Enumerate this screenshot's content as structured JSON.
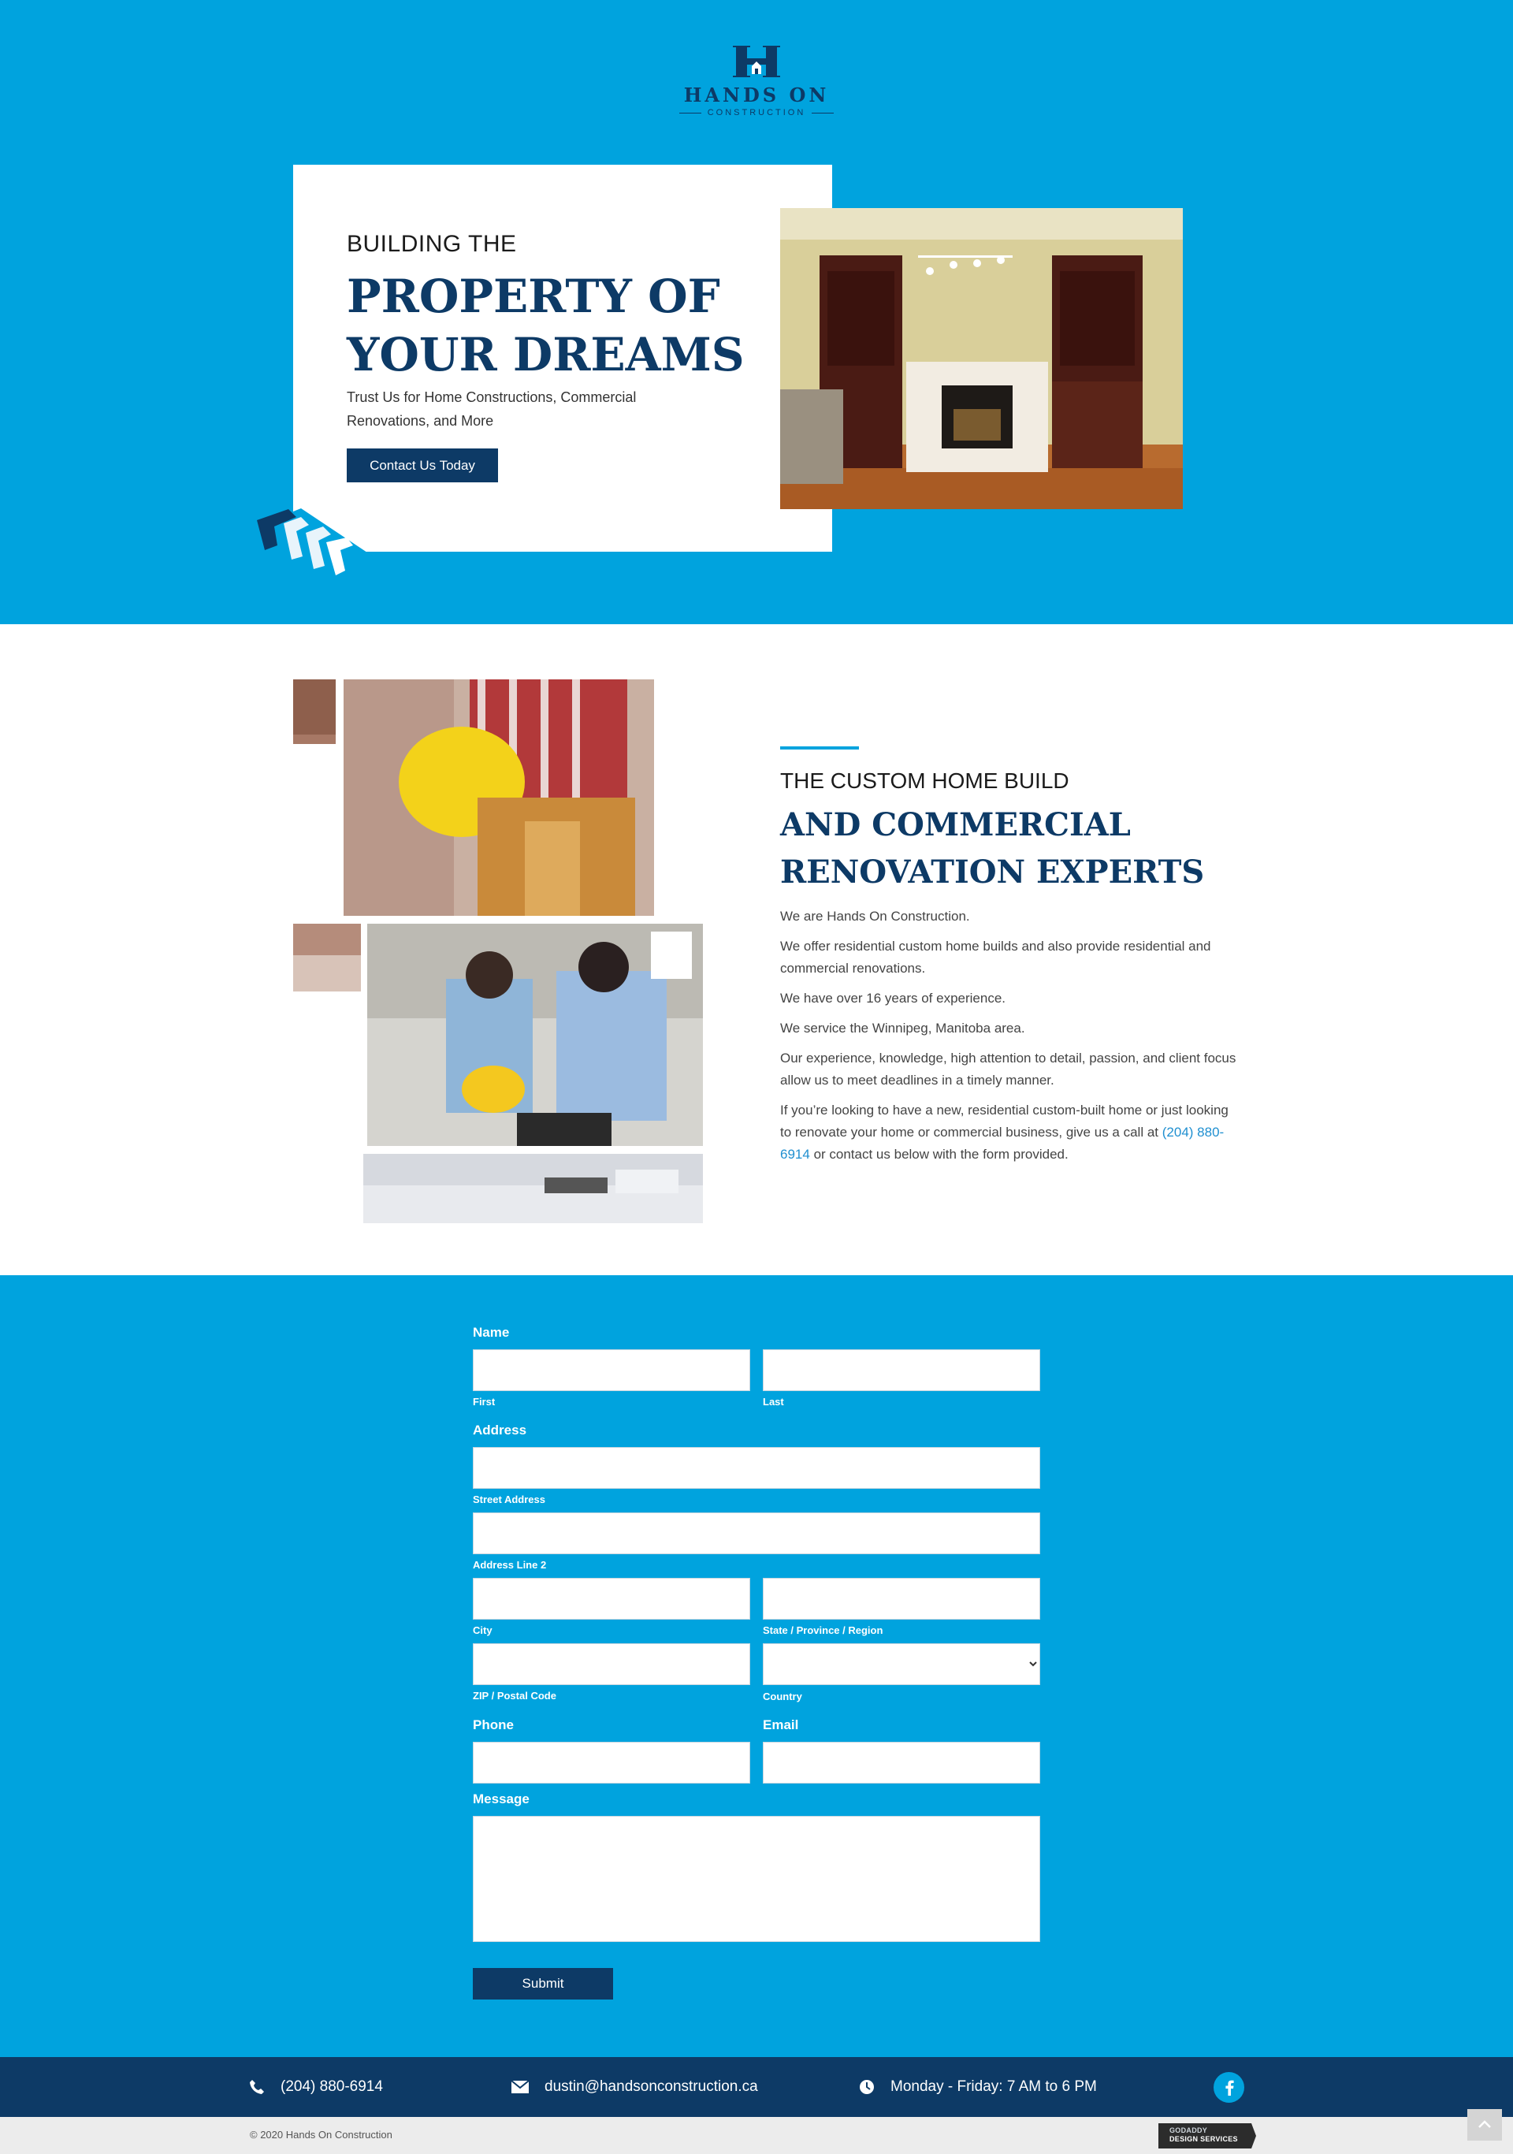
{
  "colors": {
    "brand_blue": "#00a3de",
    "navy": "#0d3a66",
    "white": "#ffffff"
  },
  "logo": {
    "brand": "HANDS ON",
    "sub": "CONSTRUCTION",
    "icon": "house-h-logo"
  },
  "hero": {
    "kicker": "BUILDING THE",
    "headline": "PROPERTY OF YOUR DREAMS",
    "tagline": "Trust Us for Home Constructions, Commercial Renovations, and More",
    "cta_label": "Contact Us Today"
  },
  "about": {
    "kicker": "THE CUSTOM HOME BUILD",
    "headline": "AND COMMERCIAL RENOVATION EXPERTS",
    "paragraphs": [
      "We are Hands On Construction.",
      "We offer residential custom home builds and also provide residential and commercial renovations.",
      "We have over 16 years of experience.",
      "We service the Winnipeg, Manitoba area.",
      "Our experience, knowledge, high attention to detail, passion, and client focus allow us to meet deadlines in a timely manner."
    ],
    "last_paragraph_before": "If you’re looking to have a new, residential custom-built home or just looking to renovate your home or commercial business, give us a call at",
    "phone_link": "(204) 880-6914",
    "last_paragraph_after": "or contact us below with the form provided."
  },
  "form": {
    "name_label": "Name",
    "first_label": "First",
    "last_label": "Last",
    "address_label": "Address",
    "street_label": "Street Address",
    "line2_label": "Address Line 2",
    "city_label": "City",
    "state_label": "State / Province / Region",
    "zip_label": "ZIP / Postal Code",
    "country_label": "Country",
    "country_value": "",
    "phone_label": "Phone",
    "email_label": "Email",
    "message_label": "Message",
    "submit_label": "Submit"
  },
  "footer": {
    "phone": "(204) 880-6914",
    "email": "dustin@handsonconstruction.ca",
    "hours": "Monday - Friday: 7 AM to 6 PM",
    "social_icon": "facebook-icon"
  },
  "bottom": {
    "copyright": "© 2020 Hands On Construction",
    "badge_line1": "GODADDY",
    "badge_line2": "DESIGN SERVICES"
  }
}
